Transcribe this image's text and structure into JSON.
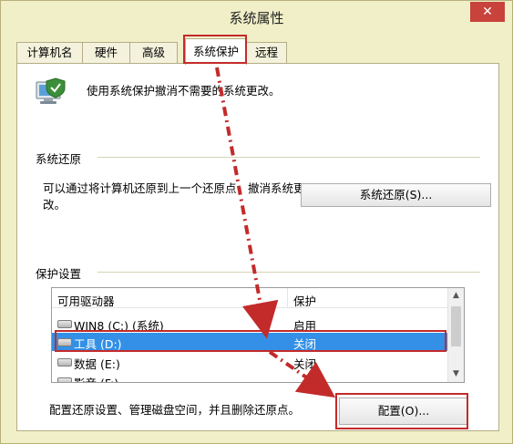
{
  "window": {
    "title": "系统属性",
    "close_symbol": "✕"
  },
  "tabs": [
    {
      "label": "计算机名",
      "active": false
    },
    {
      "label": "硬件",
      "active": false
    },
    {
      "label": "高级",
      "active": false
    },
    {
      "label": "系统保护",
      "active": true
    },
    {
      "label": "远程",
      "active": false
    }
  ],
  "intro": {
    "text": "使用系统保护撤消不需要的系统更改。",
    "icon": "computer-shield-icon"
  },
  "system_restore": {
    "section_label": "系统还原",
    "description": "可以通过将计算机还原到上一个还原点，撤消系统更改。",
    "button_label": "系统还原(S)..."
  },
  "protection_settings": {
    "section_label": "保护设置",
    "columns": [
      "可用驱动器",
      "保护"
    ],
    "drives": [
      {
        "name": "WIN8 (C:) (系统)",
        "status": "启用",
        "selected": false
      },
      {
        "name": "工具 (D:)",
        "status": "关闭",
        "selected": true
      },
      {
        "name": "数据 (E:)",
        "status": "关闭",
        "selected": false
      },
      {
        "name": "影音 (F:)",
        "status": "",
        "selected": false
      }
    ],
    "config_text": "配置还原设置、管理磁盘空间，并且删除还原点。",
    "config_button_label": "配置(O)..."
  },
  "colors": {
    "window_bg": "#f0efc8",
    "selection": "#3390e6",
    "annotation_red": "#c32b2b",
    "close_red": "#c7433b"
  }
}
